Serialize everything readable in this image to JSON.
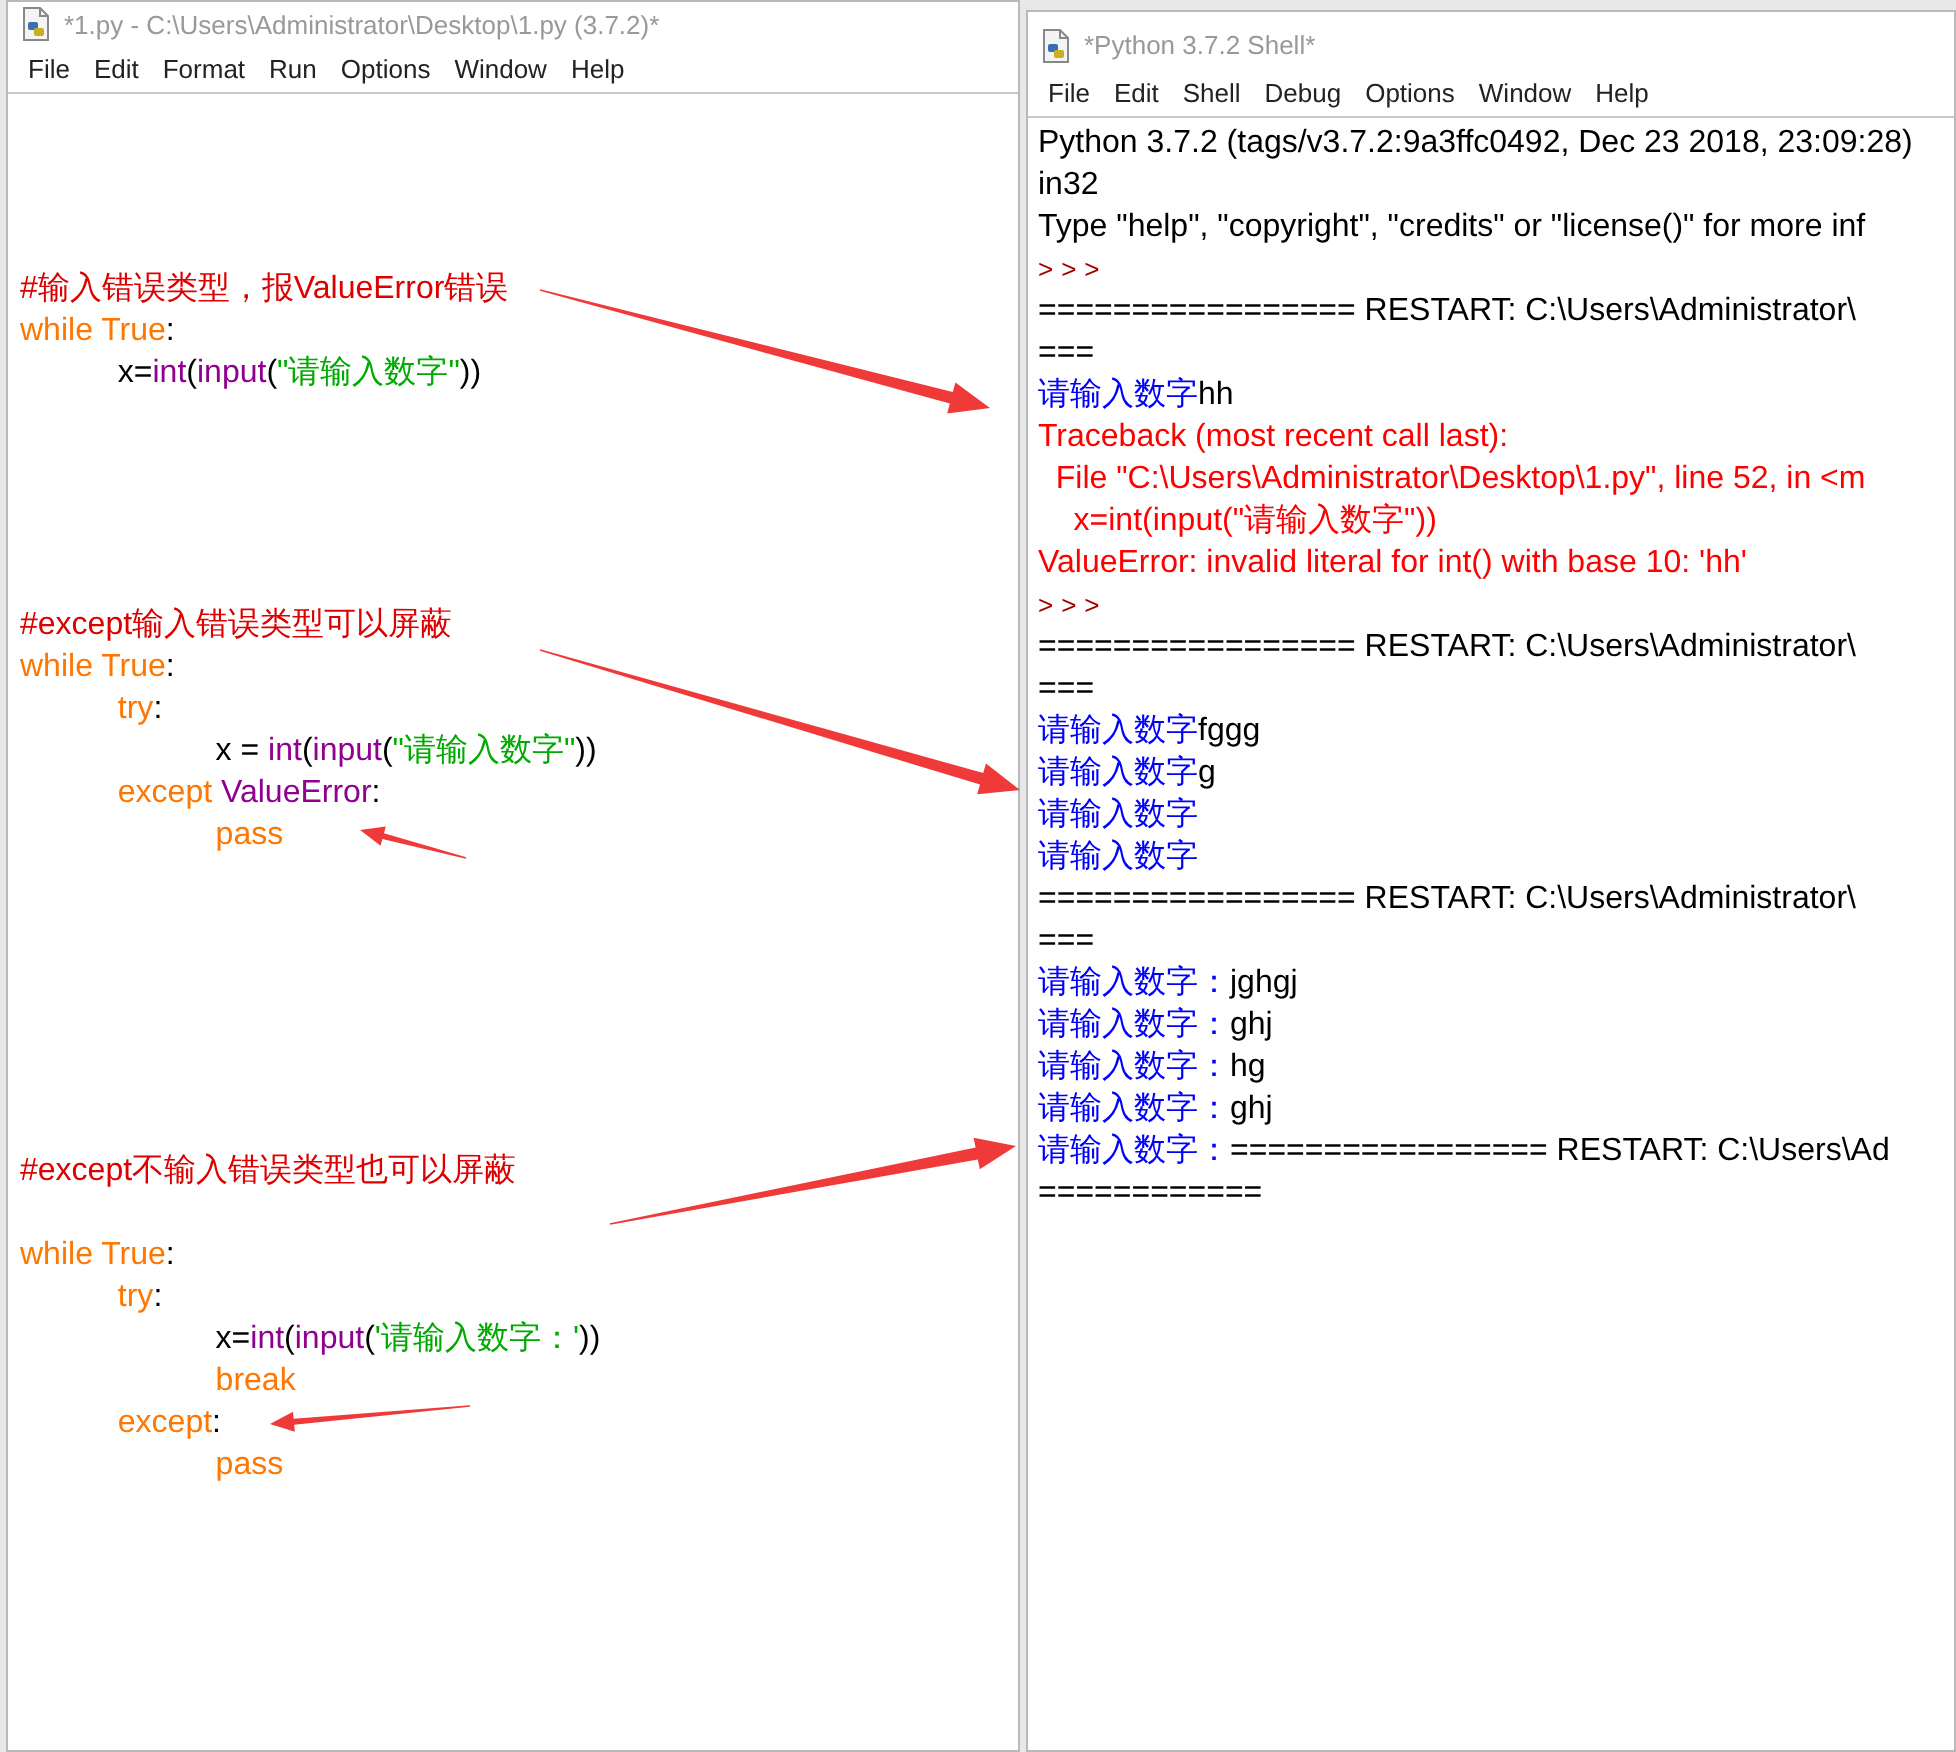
{
  "editor": {
    "title": "*1.py - C:\\Users\\Administrator\\Desktop\\1.py (3.7.2)*",
    "menu": [
      "File",
      "Edit",
      "Format",
      "Run",
      "Options",
      "Window",
      "Help"
    ],
    "lines": [
      {
        "kind": "blank"
      },
      {
        "kind": "blank"
      },
      {
        "kind": "blank"
      },
      {
        "kind": "blank"
      },
      {
        "kind": "code",
        "tokens": [
          {
            "kind": "comment",
            "text": "#输入错误类型，报ValueError错误"
          }
        ]
      },
      {
        "kind": "code",
        "tokens": [
          {
            "kind": "keyword",
            "text": "while True"
          },
          {
            "kind": "plain",
            "text": ":"
          }
        ]
      },
      {
        "kind": "code",
        "tokens": [
          {
            "kind": "plain",
            "text": "\tx="
          },
          {
            "kind": "builtin",
            "text": "int"
          },
          {
            "kind": "plain",
            "text": "("
          },
          {
            "kind": "builtin",
            "text": "input"
          },
          {
            "kind": "plain",
            "text": "("
          },
          {
            "kind": "string",
            "text": "\"请输入数字\""
          },
          {
            "kind": "plain",
            "text": "))"
          }
        ]
      },
      {
        "kind": "blank"
      },
      {
        "kind": "blank"
      },
      {
        "kind": "blank"
      },
      {
        "kind": "blank"
      },
      {
        "kind": "blank"
      },
      {
        "kind": "code",
        "tokens": [
          {
            "kind": "comment",
            "text": "#except输入错误类型可以屏蔽"
          }
        ]
      },
      {
        "kind": "code",
        "tokens": [
          {
            "kind": "keyword",
            "text": "while True"
          },
          {
            "kind": "plain",
            "text": ":"
          }
        ]
      },
      {
        "kind": "code",
        "tokens": [
          {
            "kind": "keyword",
            "text": "\ttry"
          },
          {
            "kind": "plain",
            "text": ":"
          }
        ]
      },
      {
        "kind": "code",
        "tokens": [
          {
            "kind": "plain",
            "text": "\t\tx = "
          },
          {
            "kind": "builtin",
            "text": "int"
          },
          {
            "kind": "plain",
            "text": "("
          },
          {
            "kind": "builtin",
            "text": "input"
          },
          {
            "kind": "plain",
            "text": "("
          },
          {
            "kind": "string",
            "text": "\"请输入数字\""
          },
          {
            "kind": "plain",
            "text": "))"
          }
        ]
      },
      {
        "kind": "code",
        "tokens": [
          {
            "kind": "keyword",
            "text": "\texcept"
          },
          {
            "kind": "builtin",
            "text": " ValueError"
          },
          {
            "kind": "plain",
            "text": ":"
          }
        ]
      },
      {
        "kind": "code",
        "tokens": [
          {
            "kind": "keyword",
            "text": "\t\tpass"
          }
        ]
      },
      {
        "kind": "blank"
      },
      {
        "kind": "blank"
      },
      {
        "kind": "blank"
      },
      {
        "kind": "blank"
      },
      {
        "kind": "blank"
      },
      {
        "kind": "blank"
      },
      {
        "kind": "blank"
      },
      {
        "kind": "code",
        "tokens": [
          {
            "kind": "comment",
            "text": "#except不输入错误类型也可以屏蔽"
          }
        ]
      },
      {
        "kind": "blank"
      },
      {
        "kind": "code",
        "tokens": [
          {
            "kind": "keyword",
            "text": "while True"
          },
          {
            "kind": "plain",
            "text": ":"
          }
        ]
      },
      {
        "kind": "code",
        "tokens": [
          {
            "kind": "keyword",
            "text": "\ttry"
          },
          {
            "kind": "plain",
            "text": ":"
          }
        ]
      },
      {
        "kind": "code",
        "tokens": [
          {
            "kind": "plain",
            "text": "\t\tx="
          },
          {
            "kind": "builtin",
            "text": "int"
          },
          {
            "kind": "plain",
            "text": "("
          },
          {
            "kind": "builtin",
            "text": "input"
          },
          {
            "kind": "plain",
            "text": "("
          },
          {
            "kind": "string",
            "text": "'请输入数字：'"
          },
          {
            "kind": "plain",
            "text": "))"
          }
        ]
      },
      {
        "kind": "code",
        "tokens": [
          {
            "kind": "keyword",
            "text": "\t\tbreak"
          }
        ]
      },
      {
        "kind": "code",
        "tokens": [
          {
            "kind": "keyword",
            "text": "\texcept"
          },
          {
            "kind": "plain",
            "text": ":"
          }
        ]
      },
      {
        "kind": "code",
        "tokens": [
          {
            "kind": "keyword",
            "text": "\t\tpass"
          }
        ]
      }
    ]
  },
  "shell": {
    "title": "*Python 3.7.2 Shell*",
    "menu": [
      "File",
      "Edit",
      "Shell",
      "Debug",
      "Options",
      "Window",
      "Help"
    ],
    "lines": [
      [
        {
          "kind": "plain",
          "text": "Python 3.7.2 (tags/v3.7.2:9a3ffc0492, Dec 23 2018, 23:09:28)"
        }
      ],
      [
        {
          "kind": "plain",
          "text": "in32"
        }
      ],
      [
        {
          "kind": "plain",
          "text": "Type \"help\", \"copyright\", \"credits\" or \"license()\" for more inf"
        }
      ],
      [
        {
          "kind": "prompt",
          "text": ">>>"
        }
      ],
      [
        {
          "kind": "plain",
          "text": "================= RESTART: C:\\Users\\Administrator\\"
        }
      ],
      [
        {
          "kind": "plain",
          "text": "==="
        }
      ],
      [
        {
          "kind": "stdout",
          "text": "请输入数字"
        },
        {
          "kind": "stdin",
          "text": "hh"
        }
      ],
      [
        {
          "kind": "stderr",
          "text": "Traceback (most recent call last):"
        }
      ],
      [
        {
          "kind": "stderr",
          "text": "  File \"C:\\Users\\Administrator\\Desktop\\1.py\", line 52, in <m"
        }
      ],
      [
        {
          "kind": "stderr",
          "text": "    x=int(input(\"请输入数字\"))"
        }
      ],
      [
        {
          "kind": "stderr",
          "text": "ValueError: invalid literal for int() with base 10: 'hh'"
        }
      ],
      [
        {
          "kind": "prompt",
          "text": ">>>"
        }
      ],
      [
        {
          "kind": "plain",
          "text": "================= RESTART: C:\\Users\\Administrator\\"
        }
      ],
      [
        {
          "kind": "plain",
          "text": "==="
        }
      ],
      [
        {
          "kind": "stdout",
          "text": "请输入数字"
        },
        {
          "kind": "stdin",
          "text": "fggg"
        }
      ],
      [
        {
          "kind": "stdout",
          "text": "请输入数字"
        },
        {
          "kind": "stdin",
          "text": "g"
        }
      ],
      [
        {
          "kind": "stdout",
          "text": "请输入数字"
        }
      ],
      [
        {
          "kind": "stdout",
          "text": "请输入数字"
        }
      ],
      [
        {
          "kind": "plain",
          "text": "================= RESTART: C:\\Users\\Administrator\\"
        }
      ],
      [
        {
          "kind": "plain",
          "text": "==="
        }
      ],
      [
        {
          "kind": "stdout",
          "text": "请输入数字："
        },
        {
          "kind": "stdin",
          "text": "jghgj"
        }
      ],
      [
        {
          "kind": "stdout",
          "text": "请输入数字："
        },
        {
          "kind": "stdin",
          "text": "ghj"
        }
      ],
      [
        {
          "kind": "stdout",
          "text": "请输入数字："
        },
        {
          "kind": "stdin",
          "text": "hg"
        }
      ],
      [
        {
          "kind": "stdout",
          "text": "请输入数字："
        },
        {
          "kind": "stdin",
          "text": "ghj"
        }
      ],
      [
        {
          "kind": "stdout",
          "text": "请输入数字："
        },
        {
          "kind": "plain",
          "text": "================= RESTART: C:\\Users\\Ad"
        }
      ],
      [
        {
          "kind": "plain",
          "text": "============"
        }
      ]
    ]
  }
}
